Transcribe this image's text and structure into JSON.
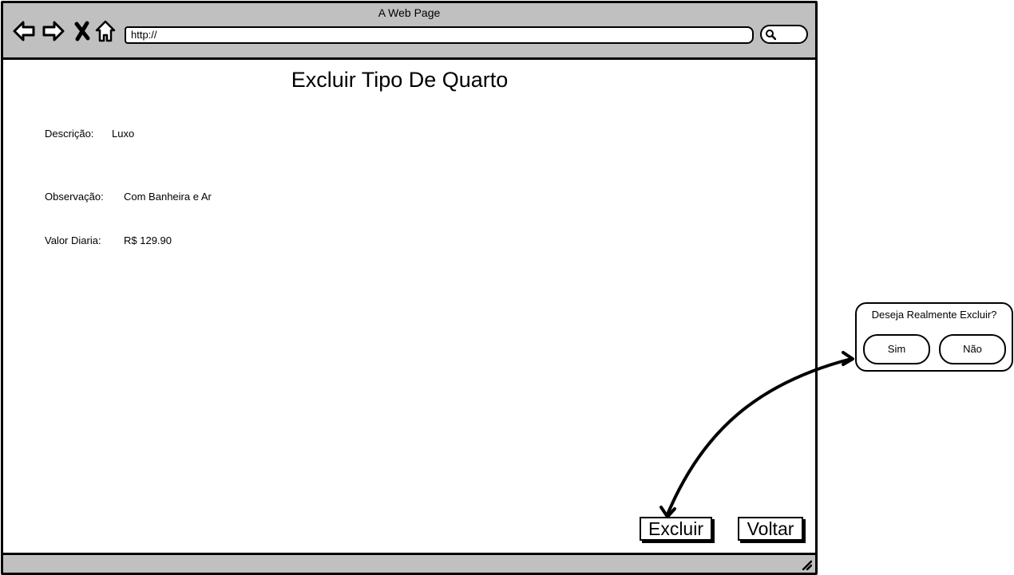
{
  "window": {
    "title": "A Web Page"
  },
  "toolbar": {
    "url": "http://"
  },
  "page": {
    "title": "Excluir Tipo De Quarto",
    "fields": [
      {
        "label": "Descrição:",
        "value": "Luxo"
      },
      {
        "label": "Observação:",
        "value": "Com Banheira e Ar"
      },
      {
        "label": "Valor Diaria:",
        "value": "R$ 129.90"
      }
    ],
    "buttons": {
      "delete": "Excluir",
      "back": "Voltar"
    }
  },
  "dialog": {
    "question": "Deseja Realmente Excluir?",
    "yes": "Sim",
    "no": "Não"
  }
}
